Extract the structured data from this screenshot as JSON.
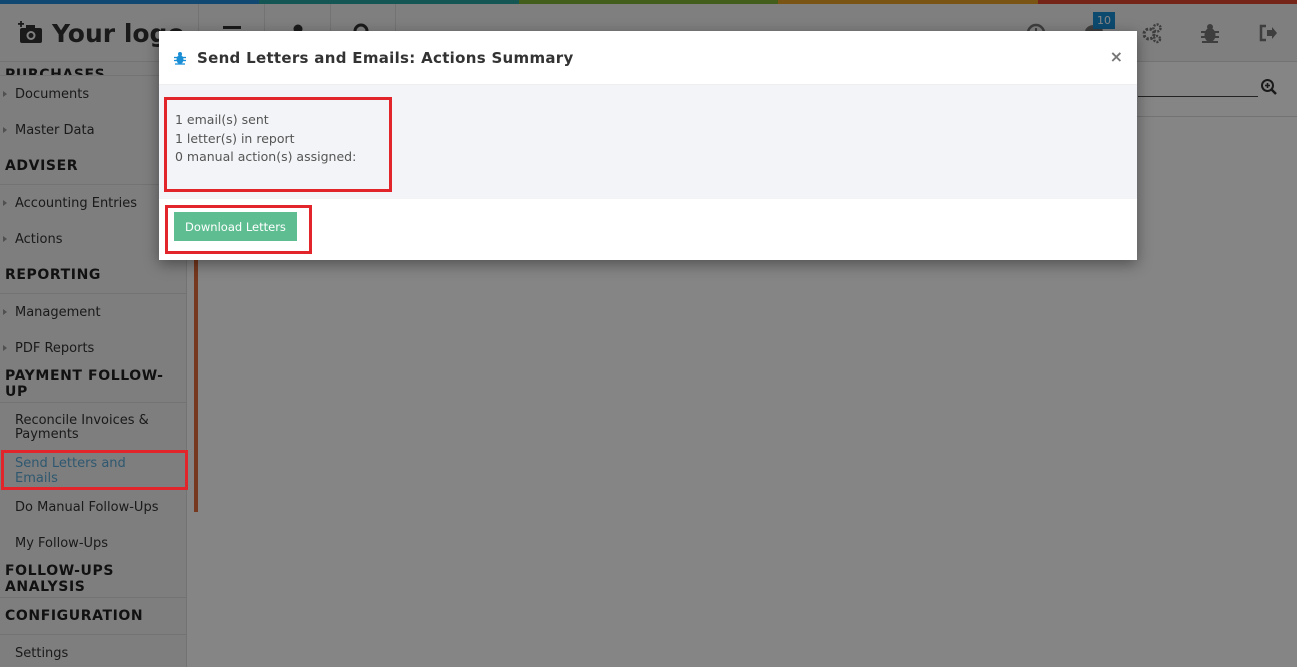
{
  "colors": {
    "strip": [
      "#1f8ad8",
      "#27a5a0",
      "#7fb532",
      "#e8a226",
      "#e0482c"
    ],
    "accent_button": "#5fbd92",
    "active_link": "#5aa9d6",
    "badge": "#1a8fd6",
    "highlight": "#e1252b"
  },
  "header": {
    "logo_text": "Your logo",
    "notifications_count": "10"
  },
  "sidebar": {
    "partial_section": "PURCHASES",
    "items": [
      {
        "label": "Documents",
        "type": "item",
        "arrow": true
      },
      {
        "label": "Master Data",
        "type": "item",
        "arrow": true
      },
      {
        "label": "ADVISER",
        "type": "section"
      },
      {
        "label": "Accounting Entries",
        "type": "item",
        "arrow": true
      },
      {
        "label": "Actions",
        "type": "item",
        "arrow": true
      },
      {
        "label": "REPORTING",
        "type": "section"
      },
      {
        "label": "Management",
        "type": "item",
        "arrow": true
      },
      {
        "label": "PDF Reports",
        "type": "item",
        "arrow": true
      },
      {
        "label": "PAYMENT FOLLOW-UP",
        "type": "section"
      },
      {
        "label": "Reconcile Invoices & Payments",
        "type": "item"
      },
      {
        "label": "Send Letters and Emails",
        "type": "item",
        "active": true
      },
      {
        "label": "Do Manual Follow-Ups",
        "type": "item"
      },
      {
        "label": "My Follow-Ups",
        "type": "item"
      },
      {
        "label": "FOLLOW-UPS ANALYSIS",
        "type": "section"
      },
      {
        "label": "CONFIGURATION",
        "type": "section"
      },
      {
        "label": "Settings",
        "type": "item"
      }
    ]
  },
  "modal": {
    "title": "Send Letters and Emails: Actions Summary",
    "close_label": "×",
    "lines": [
      "1 email(s) sent",
      "1 letter(s) in report",
      "0 manual action(s) assigned:"
    ],
    "download_label": "Download Letters"
  }
}
